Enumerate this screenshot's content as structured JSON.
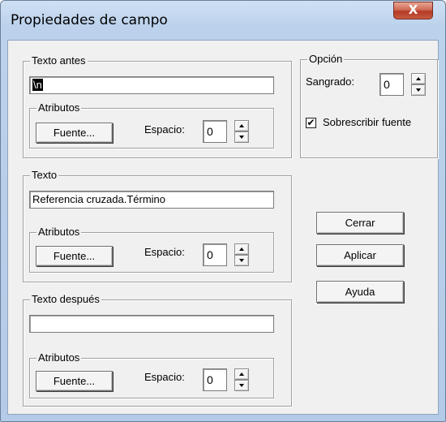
{
  "window": {
    "title": "Propiedades de campo",
    "close_glyph": "X"
  },
  "texto_antes": {
    "legend": "Texto antes",
    "value": "\\n",
    "atributos": {
      "legend": "Atributos",
      "font_button": "Fuente...",
      "spacing_label": "Espacio:",
      "spacing_value": "0"
    }
  },
  "texto": {
    "legend": "Texto",
    "value": "Referencia cruzada.Término",
    "atributos": {
      "legend": "Atributos",
      "font_button": "Fuente...",
      "spacing_label": "Espacio:",
      "spacing_value": "0"
    }
  },
  "texto_despues": {
    "legend": "Texto después",
    "value": "",
    "atributos": {
      "legend": "Atributos",
      "font_button": "Fuente...",
      "spacing_label": "Espacio:",
      "spacing_value": "0"
    }
  },
  "opcion": {
    "legend": "Opción",
    "indent_label": "Sangrado:",
    "indent_value": "0",
    "overwrite_font_label": "Sobrescribir fuente",
    "overwrite_font_checked": true,
    "check_glyph": "✔"
  },
  "buttons": {
    "close": "Cerrar",
    "apply": "Aplicar",
    "help": "Ayuda"
  },
  "icons": [
    "close-icon",
    "spin-up-icon",
    "spin-down-icon",
    "checkmark-icon"
  ]
}
